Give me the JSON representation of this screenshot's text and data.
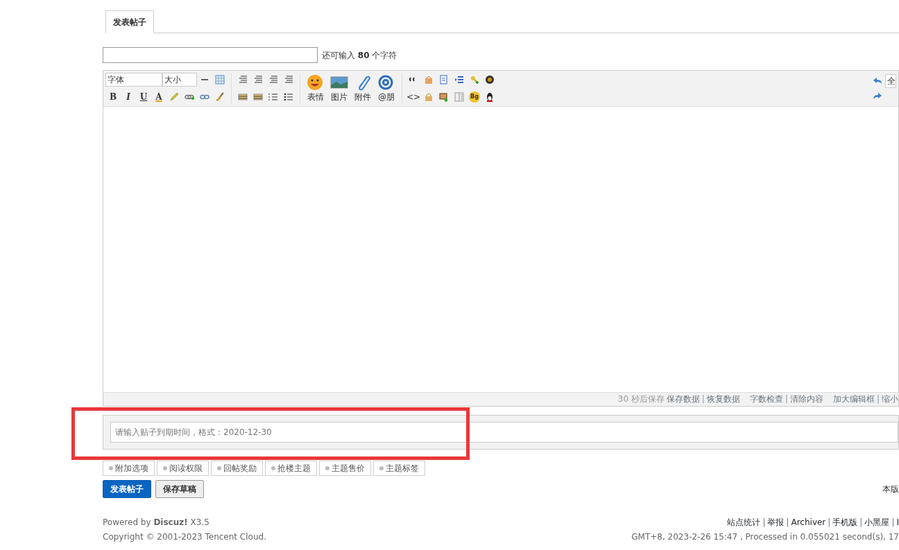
{
  "tabs": [
    {
      "label": "发表帖子",
      "selected": true
    }
  ],
  "subject": {
    "counter": "还可输入 **80** 个字符"
  },
  "editor": {
    "font_select": "字体",
    "size_select": "大小",
    "format_keys": {
      "bold": "B",
      "italic": "I",
      "underline": "U",
      "fontcolor": "A",
      "code": "<>",
      "background": "Bg"
    },
    "big_buttons": [
      "表情",
      "图片",
      "附件",
      "@朋"
    ],
    "right_field": "全",
    "status": {
      "separator": "|",
      "autosave": "30 秒后保存",
      "links_a": [
        "保存数据",
        "恢复数据"
      ],
      "links_b": [
        "字数检查",
        "清除内容"
      ],
      "links_c": [
        "加大编辑框",
        "缩小"
      ]
    }
  },
  "expire": {
    "placeholder": "请输入贴子到期时间，格式：2020-12-30"
  },
  "option_tabs": [
    {
      "label": "附加选项"
    },
    {
      "label": "阅读权限"
    },
    {
      "label": "回帖奖励"
    },
    {
      "label": "抢楼主题"
    },
    {
      "label": "主题售价"
    },
    {
      "label": "主题标签"
    }
  ],
  "buttons": [
    {
      "label": "发表帖子",
      "kind": "primary"
    },
    {
      "label": "保存草稿",
      "kind": "secondary"
    }
  ],
  "side_note": "本版",
  "footer": {
    "separator": "|",
    "powered": "Powered by **Discuz!** X3.5",
    "copyright": "Copyright © 2001-2023 Tencent Cloud.",
    "links": [
      "站点统计",
      "举报",
      "Archiver",
      "手机版",
      "小黑屋",
      "I"
    ],
    "time": "GMT+8, 2023-2-26 15:47 , Processed in 0.055021 second(s), 17"
  }
}
